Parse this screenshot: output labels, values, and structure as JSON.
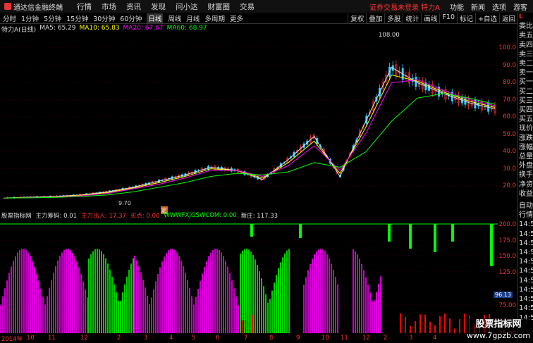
{
  "app": {
    "name": "通达信金融终端",
    "menu": [
      "行情",
      "市场",
      "资讯",
      "发现",
      "问小达",
      "财富圈",
      "交易"
    ],
    "notice": "证券交易未登录 特力A",
    "right_menu": [
      "功能",
      "新闻",
      "选项",
      "游客"
    ]
  },
  "toolbar": {
    "periods": [
      "分时",
      "1分钟",
      "5分钟",
      "15分钟",
      "30分钟",
      "60分钟",
      "日线",
      "周线",
      "月线",
      "多周期",
      "更多"
    ],
    "active_period": "日线",
    "tools": [
      "复权",
      "叠加",
      "多股",
      "统计",
      "画线",
      "F10",
      "标记",
      "+自选",
      "返回"
    ]
  },
  "legend": {
    "title": "特力A(日线)",
    "ma5": "MA5: 65.29",
    "ma10": "MA10: 65.83",
    "ma20": "MA20: 67.67",
    "ma60": "MA60: 68.97"
  },
  "price_annotations": {
    "high": "108.00",
    "low": "9.70"
  },
  "price_axis": [
    "100.0",
    "90.0",
    "80.0",
    "70.0",
    "60.0",
    "50.0",
    "40.0",
    "30.0",
    "20.0"
  ],
  "indicator": {
    "name": "股票指标网",
    "label1": "主力筹码: 0.01",
    "label2": "主力出入: 17.37",
    "label3": "买点: 0.00",
    "label4": "WWWFXJGSWCOM: 0.00",
    "label5": "新庄: 117.33"
  },
  "ind_axis": [
    "200.0",
    "175.0",
    "150.0",
    "125.0",
    "75.00",
    "50.00",
    "25.00"
  ],
  "ind_value_box": "96.13",
  "xaxis": [
    {
      "t": "2014年"
    },
    {
      "t": "10"
    },
    {
      "t": "11"
    },
    {
      "t": "12"
    },
    {
      "t": "2"
    },
    {
      "t": "3"
    },
    {
      "t": "4"
    },
    {
      "t": "5"
    },
    {
      "t": "6"
    },
    {
      "t": "7"
    },
    {
      "t": "8"
    },
    {
      "t": "9"
    },
    {
      "t": "10"
    },
    {
      "t": "11"
    },
    {
      "t": "12"
    },
    {
      "t": "2"
    },
    {
      "t": "3"
    },
    {
      "t": "4"
    }
  ],
  "cursor_label": "定",
  "sidepanel": {
    "top": [
      "委比",
      "卖五",
      "卖四",
      "卖三",
      "卖二",
      "卖一",
      "买一",
      "买二",
      "买三",
      "买四",
      "买五",
      "现价",
      "涨跌",
      "涨幅",
      "总量",
      "外盘",
      "换手",
      "净资",
      "收益"
    ],
    "bottom": [
      "自动",
      "行情",
      "14:5",
      "14:5",
      "14:5",
      "14:5",
      "14:5",
      "14:5",
      "14:5",
      "14:5",
      "14:5",
      "14:5",
      "14:5"
    ]
  },
  "watermark": {
    "main": "股票指标网",
    "url": "www.7gpzb.com"
  },
  "chart_data": {
    "type": "line",
    "title": "",
    "x": [
      "2014-09",
      "2014-10",
      "2014-11",
      "2014-12",
      "2015-01",
      "2015-02",
      "2015-03",
      "2015-04",
      "2015-05",
      "2015-06",
      "2015-07",
      "2015-08",
      "2015-09",
      "2015-10",
      "2015-11",
      "2015-12",
      "2016-01",
      "2016-02",
      "2016-03",
      "2016-04"
    ],
    "series": [
      {
        "name": "MA5",
        "values": [
          10,
          10.5,
          11,
          12,
          14,
          17,
          21,
          25,
          30,
          28,
          22,
          35,
          50,
          24,
          60,
          95,
          85,
          78,
          72,
          68
        ]
      },
      {
        "name": "MA10",
        "values": [
          10,
          10.3,
          10.8,
          11.8,
          13.5,
          16.5,
          20,
          24,
          29,
          28,
          23,
          33,
          47,
          26,
          56,
          90,
          86,
          79,
          73,
          69
        ]
      },
      {
        "name": "MA20",
        "values": [
          10,
          10.2,
          10.6,
          11.5,
          13,
          16,
          19,
          23,
          28,
          28,
          24,
          31,
          44,
          28,
          52,
          85,
          87,
          80,
          74,
          70
        ]
      },
      {
        "name": "MA60",
        "values": [
          10,
          10.1,
          10.4,
          11,
          12,
          14,
          17,
          20,
          24,
          26,
          25,
          27,
          33,
          30,
          40,
          60,
          75,
          78,
          75,
          71
        ]
      }
    ],
    "ylim": [
      5,
      115
    ]
  }
}
